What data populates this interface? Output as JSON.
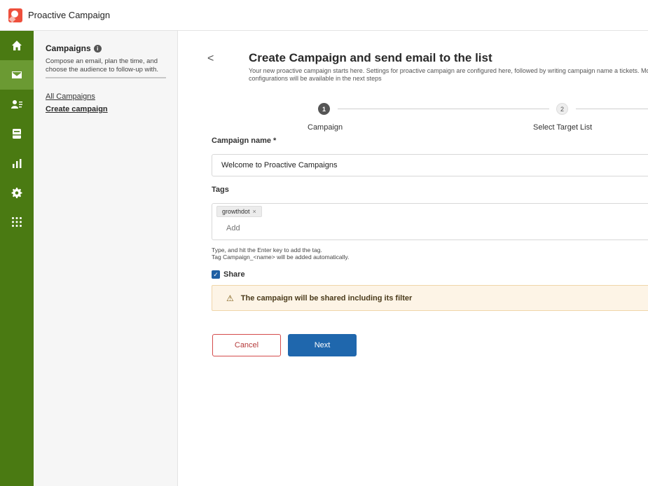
{
  "app": {
    "title": "Proactive Campaign"
  },
  "rail": {
    "items": [
      {
        "icon": "home-icon",
        "active": false
      },
      {
        "icon": "mail-icon",
        "active": true
      },
      {
        "icon": "contacts-icon",
        "active": false
      },
      {
        "icon": "inbox-icon",
        "active": false
      },
      {
        "icon": "chart-icon",
        "active": false
      },
      {
        "icon": "gear-icon",
        "active": false
      },
      {
        "icon": "apps-grid-icon",
        "active": false
      }
    ],
    "bg_color": "#4a7a12",
    "active_color": "#6b9a33"
  },
  "sidebar": {
    "title": "Campaigns",
    "description": "Compose an email, plan the time, and choose the audience to follow-up with.",
    "links": [
      {
        "label": "All Campaigns"
      },
      {
        "label": "Create campaign"
      }
    ]
  },
  "page": {
    "back_label": "<",
    "title": "Create Campaign and send email to the list",
    "subtitle": "Your new proactive campaign starts here. Settings for proactive campaign are configured here, followed by writing campaign name a tickets. More configurations will be available in the next steps"
  },
  "stepper": {
    "steps": [
      {
        "number": "1",
        "label": "Campaign",
        "active": true
      },
      {
        "number": "2",
        "label": "Select Target List",
        "active": false
      }
    ]
  },
  "form": {
    "campaign_name_label": "Campaign name *",
    "campaign_name_value": "Welcome to Proactive Campaigns",
    "tags_label": "Tags",
    "tags": [
      {
        "label": "growthdot",
        "remove": "×"
      }
    ],
    "tag_placeholder": "Add",
    "helper_line1": "Type, and hit the Enter key to add the tag.",
    "helper_line2": "Tag Campaign_<name> will be added automatically.",
    "share_label": "Share",
    "share_checked": true,
    "warning_text": "The campaign will be shared including its filter"
  },
  "actions": {
    "cancel_label": "Cancel",
    "next_label": "Next",
    "primary_color": "#1f67ad",
    "danger_color": "#d44b4b"
  }
}
